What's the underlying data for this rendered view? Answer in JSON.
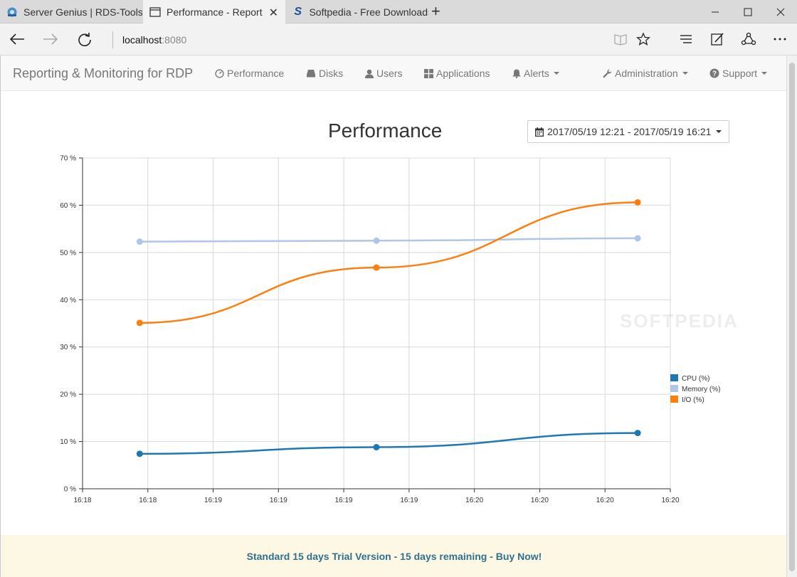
{
  "browser": {
    "tabs": [
      {
        "label": "Server Genius | RDS-Tools",
        "icon": "server-genius-icon",
        "active": false
      },
      {
        "label": "Performance - Reporting",
        "icon": "page-icon",
        "active": true
      },
      {
        "label": "Softpedia - Free Downloads",
        "icon": "softpedia-icon",
        "active": false
      }
    ],
    "new_tab_label": "+",
    "url_host": "localhost",
    "url_port": ":8080"
  },
  "navbar": {
    "brand": "Reporting & Monitoring for RDP",
    "items": [
      {
        "label": "Performance",
        "icon": "dashboard-icon"
      },
      {
        "label": "Disks",
        "icon": "hdd-icon"
      },
      {
        "label": "Users",
        "icon": "user-icon"
      },
      {
        "label": "Applications",
        "icon": "grid-icon"
      },
      {
        "label": "Alerts",
        "icon": "bell-icon",
        "dropdown": true
      }
    ],
    "right_items": [
      {
        "label": "Administration",
        "icon": "wrench-icon",
        "dropdown": true
      },
      {
        "label": "Support",
        "icon": "question-icon",
        "dropdown": true
      }
    ]
  },
  "main": {
    "title": "Performance",
    "date_range": "2017/05/19 12:21 - 2017/05/19 16:21"
  },
  "chart_data": {
    "type": "line",
    "title": "",
    "xlabel": "",
    "ylabel": "",
    "x_ticks": [
      "16:18",
      "16:18",
      "16:19",
      "16:19",
      "16:19",
      "16:19",
      "16:20",
      "16:20",
      "16:20",
      "16:20"
    ],
    "y_ticks": [
      "0 %",
      "10 %",
      "20 %",
      "30 %",
      "40 %",
      "50 %",
      "60 %",
      "70 %"
    ],
    "ylim": [
      0,
      70
    ],
    "grid": true,
    "legend_position": "right",
    "x_positions": [
      0.875,
      4.5,
      8.5
    ],
    "series": [
      {
        "name": "CPU (%)",
        "color": "#1f77b4",
        "values": [
          7.4,
          8.8,
          11.8
        ]
      },
      {
        "name": "Memory (%)",
        "color": "#aec7e8",
        "values": [
          52.3,
          52.5,
          53.0
        ]
      },
      {
        "name": "I/O (%)",
        "color": "#ff7f0e",
        "values": [
          35.1,
          46.8,
          60.6
        ]
      }
    ]
  },
  "trial": {
    "text": "Standard 15 days Trial Version - 15 days remaining - Buy Now!"
  },
  "watermark": "SOFTPEDIA"
}
